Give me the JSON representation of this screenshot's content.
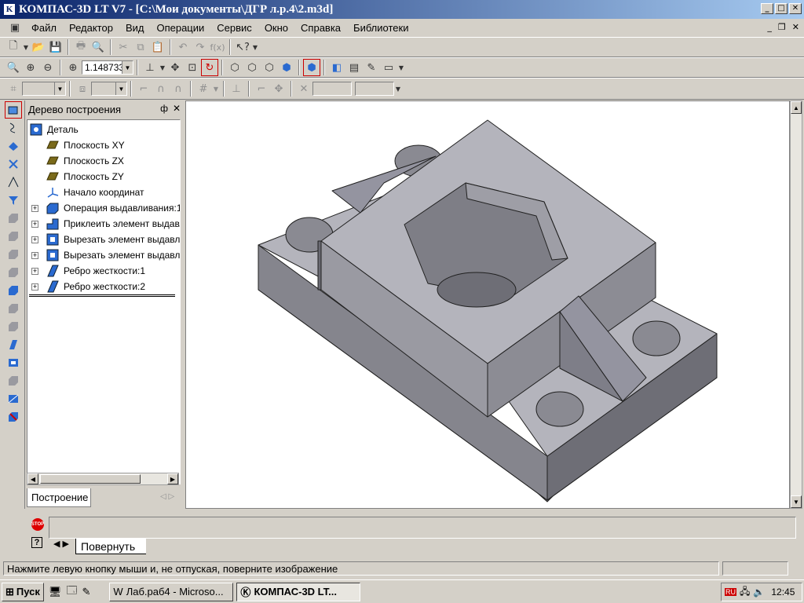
{
  "window": {
    "title": "КОМПАС-3D LT V7 - [C:\\Мои документы\\ДГР л.р.4\\2.m3d]",
    "min_glyph": "_",
    "max_glyph": "□",
    "close_glyph": "✕"
  },
  "menu": {
    "items": [
      {
        "label": "Файл"
      },
      {
        "label": "Редактор"
      },
      {
        "label": "Вид"
      },
      {
        "label": "Операции"
      },
      {
        "label": "Сервис"
      },
      {
        "label": "Окно"
      },
      {
        "label": "Справка"
      },
      {
        "label": "Библиотеки"
      }
    ],
    "doc_min": "_",
    "doc_restore": "❐",
    "doc_close": "✕"
  },
  "toolbar": {
    "zoom_value": "1.148733",
    "fx_label": "f(x)"
  },
  "tree": {
    "header": "Дерево построения",
    "pin_glyph": "ф",
    "close_glyph": "✕",
    "root": "Деталь",
    "nodes": [
      {
        "label": "Плоскость XY",
        "expandable": false
      },
      {
        "label": "Плоскость ZX",
        "expandable": false
      },
      {
        "label": "Плоскость ZY",
        "expandable": false
      },
      {
        "label": "Начало координат",
        "expandable": false
      },
      {
        "label": "Операция выдавливания:1",
        "expandable": true
      },
      {
        "label": "Приклеить элемент выдавл",
        "expandable": true
      },
      {
        "label": "Вырезать элемент выдавли",
        "expandable": true
      },
      {
        "label": "Вырезать элемент выдавли",
        "expandable": true
      },
      {
        "label": "Ребро жесткости:1",
        "expandable": true
      },
      {
        "label": "Ребро жесткости:2",
        "expandable": true
      }
    ],
    "tab_label": "Построение"
  },
  "property_bar": {
    "tab_label": "Повернуть",
    "stop_label": "STOP"
  },
  "status": {
    "message": "Нажмите левую кнопку мыши и, не отпуская, поверните изображение"
  },
  "taskbar": {
    "start_label": "Пуск",
    "tasks": [
      {
        "label": "Лаб.раб4 - Microso..."
      },
      {
        "label": "КОМПАС-3D LT..."
      }
    ],
    "tray_lang": "RU",
    "clock": "12:45"
  },
  "colors": {
    "title_start": "#0a246a",
    "title_end": "#a6caf0",
    "chrome": "#d4d0c8",
    "model_top": "#b4b4bc",
    "model_side": "#8c8c94",
    "model_front": "#7a7a82"
  }
}
